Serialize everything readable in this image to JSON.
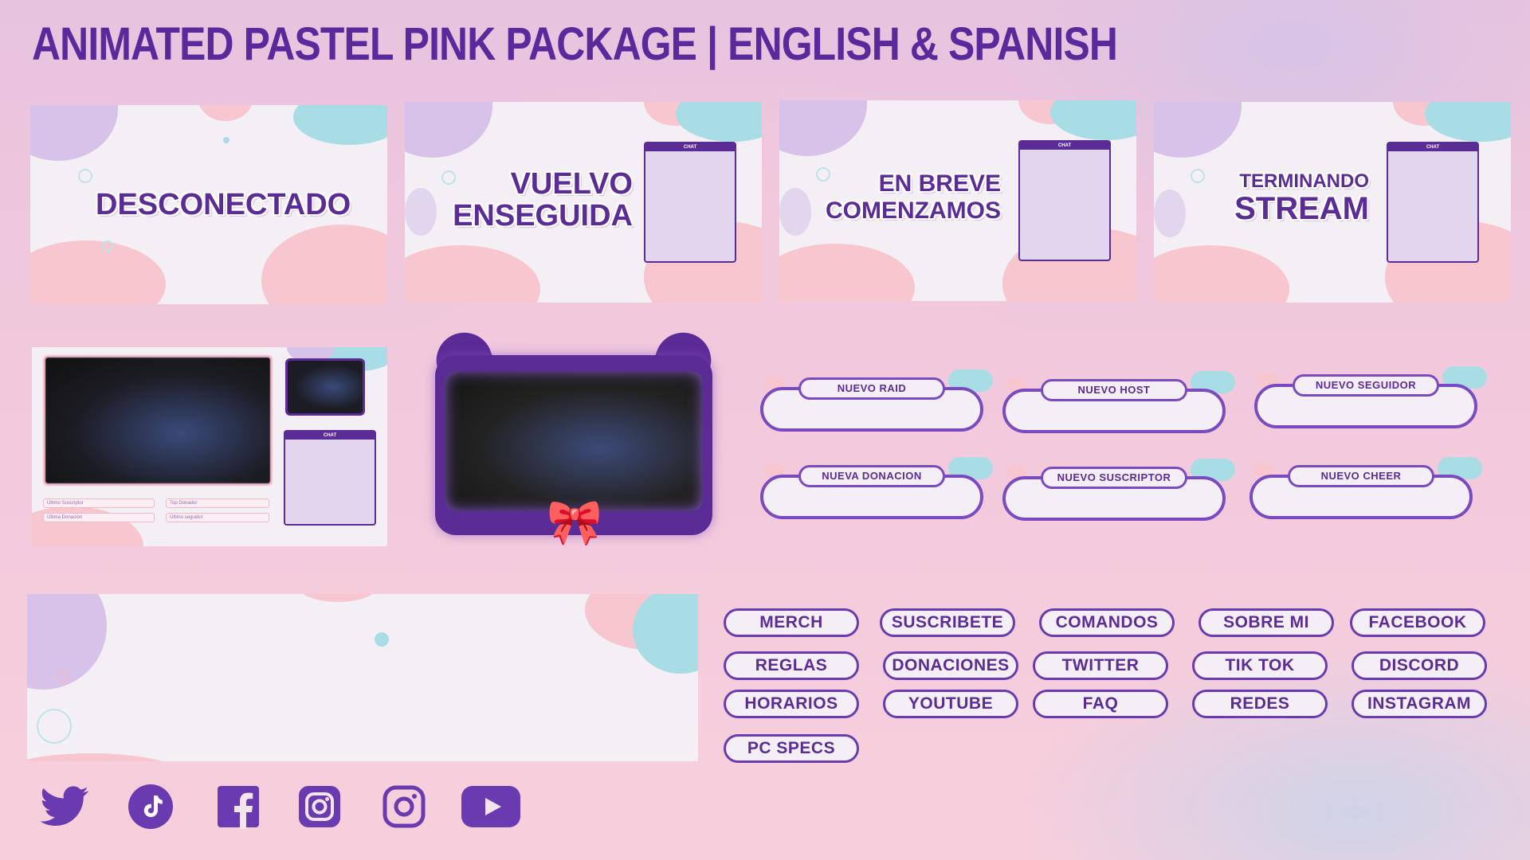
{
  "title": "ANIMATED PASTEL PINK PACKAGE | ENGLISH & SPANISH",
  "scenes": [
    {
      "line1": "DESCONECTADO",
      "line2": "",
      "has_chat": false
    },
    {
      "line1": "VUELVO",
      "line2": "ENSEGUIDA",
      "has_chat": true
    },
    {
      "line1": "EN BREVE",
      "line2": "COMENZAMOS",
      "has_chat": true
    },
    {
      "line1": "TERMINANDO",
      "line2": "STREAM",
      "has_chat": true
    }
  ],
  "chat_label": "CHAT",
  "layout": {
    "labels": [
      "Último Suscriptor",
      "Top Donador",
      "Última Donación",
      "Último seguidor"
    ]
  },
  "alerts": [
    "NUEVO RAID",
    "NUEVO HOST",
    "NUEVO SEGUIDOR",
    "NUEVA DONACION",
    "NUEVO SUSCRIPTOR",
    "NUEVO CHEER"
  ],
  "panels": [
    "MERCH",
    "SUSCRIBETE",
    "COMANDOS",
    "SOBRE MI",
    "FACEBOOK",
    "REGLAS",
    "DONACIONES",
    "TWITTER",
    "TIK TOK",
    "DISCORD",
    "HORARIOS",
    "YOUTUBE",
    "FAQ",
    "REDES",
    "INSTAGRAM",
    "PC SPECS"
  ],
  "social_icons": [
    "twitter-icon",
    "tiktok-icon",
    "facebook-icon",
    "instagram-icon",
    "instagram-outline-icon",
    "youtube-icon"
  ],
  "colors": {
    "purple": "#5b2b96",
    "pink": "#f8c6cf",
    "teal": "#a9dde6",
    "lavender": "#d7c3ea"
  }
}
